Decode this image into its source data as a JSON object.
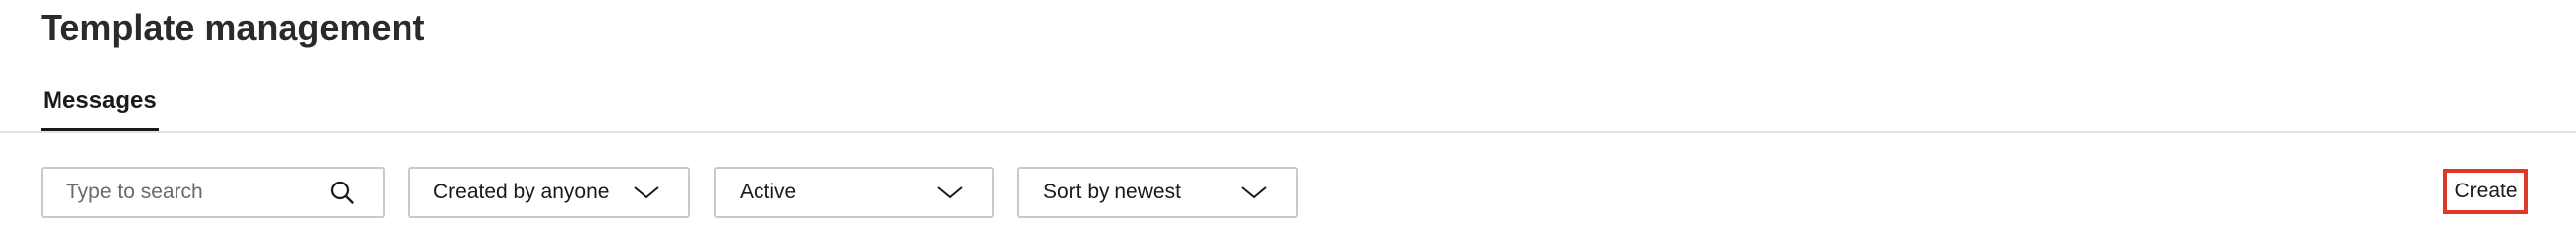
{
  "page": {
    "title": "Template management"
  },
  "tabs": [
    {
      "label": "Messages",
      "active": true
    }
  ],
  "toolbar": {
    "search": {
      "placeholder": "Type to search",
      "icon": "search-icon"
    },
    "created_by": {
      "selected": "Created by anyone",
      "icon": "chevron-down-icon"
    },
    "status": {
      "selected": "Active",
      "icon": "chevron-down-icon"
    },
    "sort": {
      "selected": "Sort by newest",
      "icon": "chevron-down-icon"
    },
    "create_label": "Create"
  },
  "colors": {
    "text": "#1a1a1a",
    "border": "#c9c9c9",
    "divider": "#e4e4e4",
    "highlight": "#e0382b"
  }
}
